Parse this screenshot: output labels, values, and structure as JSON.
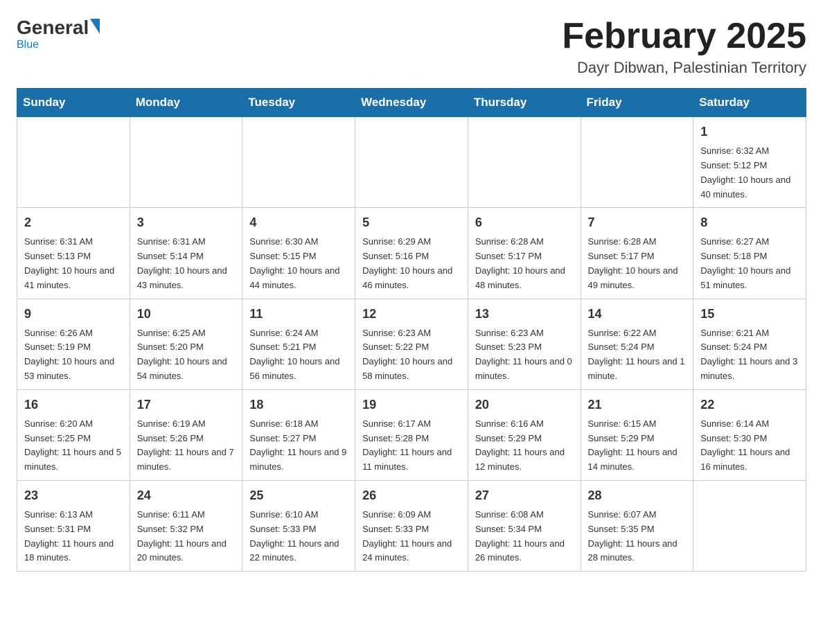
{
  "header": {
    "logo_general": "General",
    "logo_blue": "Blue",
    "title": "February 2025",
    "subtitle": "Dayr Dibwan, Palestinian Territory"
  },
  "days_of_week": [
    "Sunday",
    "Monday",
    "Tuesday",
    "Wednesday",
    "Thursday",
    "Friday",
    "Saturday"
  ],
  "weeks": [
    [
      {
        "day": "",
        "info": ""
      },
      {
        "day": "",
        "info": ""
      },
      {
        "day": "",
        "info": ""
      },
      {
        "day": "",
        "info": ""
      },
      {
        "day": "",
        "info": ""
      },
      {
        "day": "",
        "info": ""
      },
      {
        "day": "1",
        "info": "Sunrise: 6:32 AM\nSunset: 5:12 PM\nDaylight: 10 hours and 40 minutes."
      }
    ],
    [
      {
        "day": "2",
        "info": "Sunrise: 6:31 AM\nSunset: 5:13 PM\nDaylight: 10 hours and 41 minutes."
      },
      {
        "day": "3",
        "info": "Sunrise: 6:31 AM\nSunset: 5:14 PM\nDaylight: 10 hours and 43 minutes."
      },
      {
        "day": "4",
        "info": "Sunrise: 6:30 AM\nSunset: 5:15 PM\nDaylight: 10 hours and 44 minutes."
      },
      {
        "day": "5",
        "info": "Sunrise: 6:29 AM\nSunset: 5:16 PM\nDaylight: 10 hours and 46 minutes."
      },
      {
        "day": "6",
        "info": "Sunrise: 6:28 AM\nSunset: 5:17 PM\nDaylight: 10 hours and 48 minutes."
      },
      {
        "day": "7",
        "info": "Sunrise: 6:28 AM\nSunset: 5:17 PM\nDaylight: 10 hours and 49 minutes."
      },
      {
        "day": "8",
        "info": "Sunrise: 6:27 AM\nSunset: 5:18 PM\nDaylight: 10 hours and 51 minutes."
      }
    ],
    [
      {
        "day": "9",
        "info": "Sunrise: 6:26 AM\nSunset: 5:19 PM\nDaylight: 10 hours and 53 minutes."
      },
      {
        "day": "10",
        "info": "Sunrise: 6:25 AM\nSunset: 5:20 PM\nDaylight: 10 hours and 54 minutes."
      },
      {
        "day": "11",
        "info": "Sunrise: 6:24 AM\nSunset: 5:21 PM\nDaylight: 10 hours and 56 minutes."
      },
      {
        "day": "12",
        "info": "Sunrise: 6:23 AM\nSunset: 5:22 PM\nDaylight: 10 hours and 58 minutes."
      },
      {
        "day": "13",
        "info": "Sunrise: 6:23 AM\nSunset: 5:23 PM\nDaylight: 11 hours and 0 minutes."
      },
      {
        "day": "14",
        "info": "Sunrise: 6:22 AM\nSunset: 5:24 PM\nDaylight: 11 hours and 1 minute."
      },
      {
        "day": "15",
        "info": "Sunrise: 6:21 AM\nSunset: 5:24 PM\nDaylight: 11 hours and 3 minutes."
      }
    ],
    [
      {
        "day": "16",
        "info": "Sunrise: 6:20 AM\nSunset: 5:25 PM\nDaylight: 11 hours and 5 minutes."
      },
      {
        "day": "17",
        "info": "Sunrise: 6:19 AM\nSunset: 5:26 PM\nDaylight: 11 hours and 7 minutes."
      },
      {
        "day": "18",
        "info": "Sunrise: 6:18 AM\nSunset: 5:27 PM\nDaylight: 11 hours and 9 minutes."
      },
      {
        "day": "19",
        "info": "Sunrise: 6:17 AM\nSunset: 5:28 PM\nDaylight: 11 hours and 11 minutes."
      },
      {
        "day": "20",
        "info": "Sunrise: 6:16 AM\nSunset: 5:29 PM\nDaylight: 11 hours and 12 minutes."
      },
      {
        "day": "21",
        "info": "Sunrise: 6:15 AM\nSunset: 5:29 PM\nDaylight: 11 hours and 14 minutes."
      },
      {
        "day": "22",
        "info": "Sunrise: 6:14 AM\nSunset: 5:30 PM\nDaylight: 11 hours and 16 minutes."
      }
    ],
    [
      {
        "day": "23",
        "info": "Sunrise: 6:13 AM\nSunset: 5:31 PM\nDaylight: 11 hours and 18 minutes."
      },
      {
        "day": "24",
        "info": "Sunrise: 6:11 AM\nSunset: 5:32 PM\nDaylight: 11 hours and 20 minutes."
      },
      {
        "day": "25",
        "info": "Sunrise: 6:10 AM\nSunset: 5:33 PM\nDaylight: 11 hours and 22 minutes."
      },
      {
        "day": "26",
        "info": "Sunrise: 6:09 AM\nSunset: 5:33 PM\nDaylight: 11 hours and 24 minutes."
      },
      {
        "day": "27",
        "info": "Sunrise: 6:08 AM\nSunset: 5:34 PM\nDaylight: 11 hours and 26 minutes."
      },
      {
        "day": "28",
        "info": "Sunrise: 6:07 AM\nSunset: 5:35 PM\nDaylight: 11 hours and 28 minutes."
      },
      {
        "day": "",
        "info": ""
      }
    ]
  ]
}
